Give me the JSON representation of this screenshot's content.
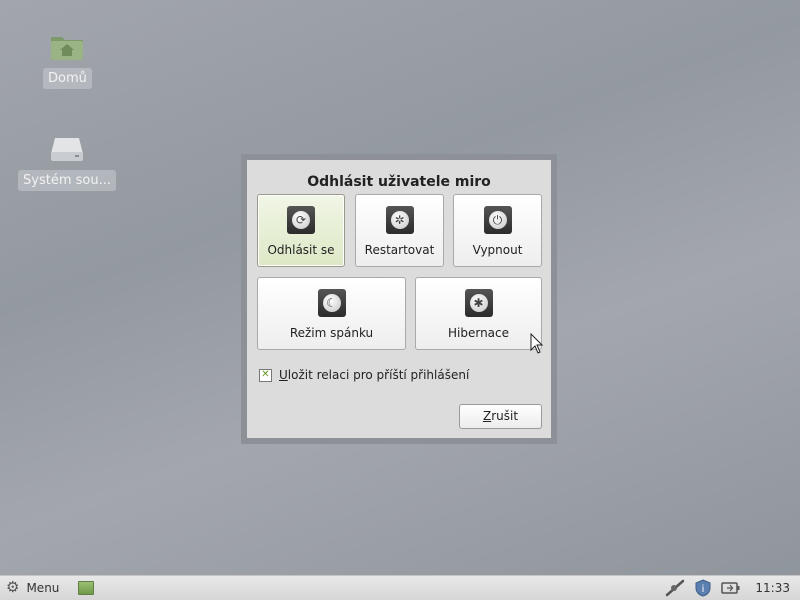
{
  "desktop": {
    "icons": [
      {
        "label": "Domů"
      },
      {
        "label": "Systém sou..."
      }
    ]
  },
  "dialog": {
    "title": "Odhlásit uživatele miro",
    "actions": [
      {
        "label": "Odhlásit se",
        "icon": "logout-icon",
        "selected": true
      },
      {
        "label": "Restartovat",
        "icon": "restart-icon"
      },
      {
        "label": "Vypnout",
        "icon": "power-icon"
      },
      {
        "label": "Režim spánku",
        "icon": "moon-icon"
      },
      {
        "label": "Hibernace",
        "icon": "hibernate-icon"
      }
    ],
    "save_session": {
      "label": "Uložit relaci pro příští přihlášení",
      "checked": true
    },
    "cancel_label": "Zrušit"
  },
  "taskbar": {
    "menu_label": "Menu",
    "clock": "11:33"
  },
  "colors": {
    "accent_green": "#6a9a2a",
    "desktop_bg": "#9a9fa5",
    "dialog_bg": "#dcdcdc"
  }
}
